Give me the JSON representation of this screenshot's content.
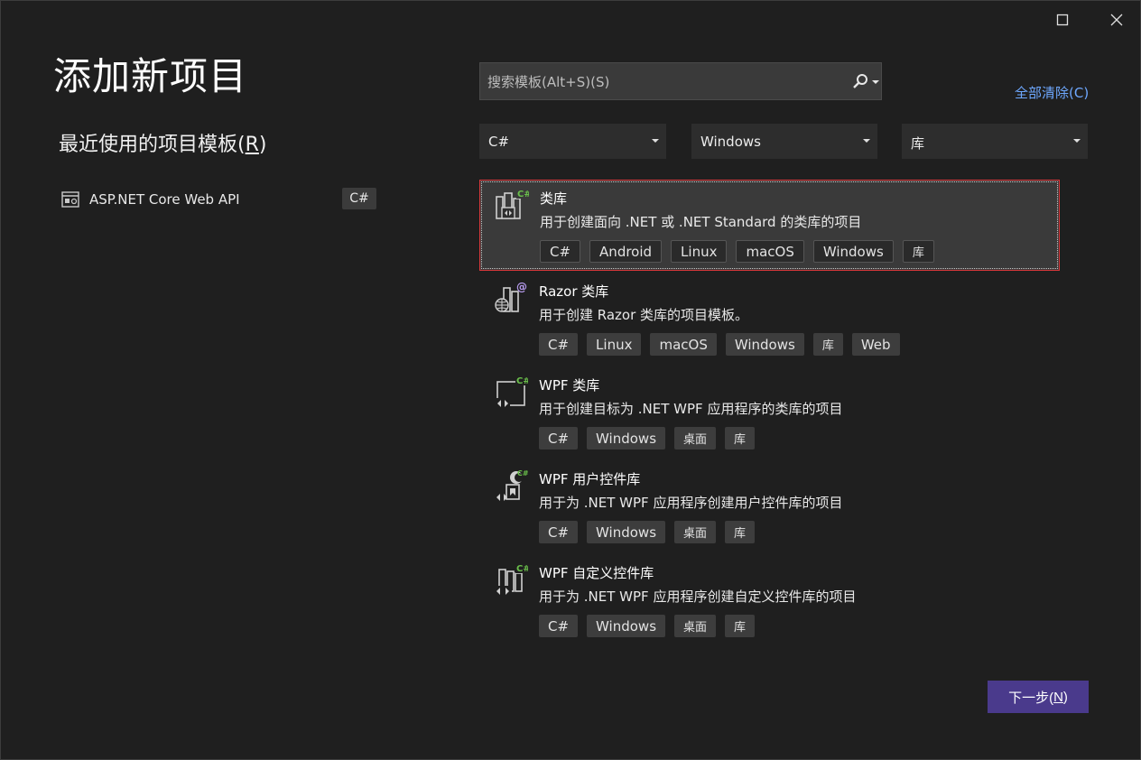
{
  "window": {
    "title": "添加新项目",
    "controls": [
      "maximize-icon",
      "close-icon"
    ]
  },
  "recent": {
    "heading": "最近使用的项目模板(R)",
    "heading_plain": "最近使用的项目模板(",
    "heading_key": "R",
    "heading_end": ")",
    "items": [
      {
        "label": "ASP.NET Core Web API",
        "lang": "C#",
        "icon": "web-api-icon"
      }
    ]
  },
  "search": {
    "placeholder": "搜索模板(Alt+S)(S)",
    "value": "",
    "icon": "search-icon"
  },
  "clear_all": "全部清除(C)",
  "filters": {
    "language": "C#",
    "platform": "Windows",
    "project_type": "库"
  },
  "templates": [
    {
      "name": "类库",
      "desc": "用于创建面向 .NET 或 .NET Standard 的类库的项目",
      "tags": [
        "C#",
        "Android",
        "Linux",
        "macOS",
        "Windows",
        "库"
      ],
      "icon": "class-library-icon",
      "selected": true
    },
    {
      "name": "Razor 类库",
      "desc": "用于创建 Razor 类库的项目模板。",
      "tags": [
        "C#",
        "Linux",
        "macOS",
        "Windows",
        "库",
        "Web"
      ],
      "icon": "razor-library-icon"
    },
    {
      "name": "WPF 类库",
      "desc": "用于创建目标为 .NET WPF 应用程序的类库的项目",
      "tags": [
        "C#",
        "Windows",
        "桌面",
        "库"
      ],
      "icon": "wpf-library-icon"
    },
    {
      "name": "WPF 用户控件库",
      "desc": "用于为 .NET WPF 应用程序创建用户控件库的项目",
      "tags": [
        "C#",
        "Windows",
        "桌面",
        "库"
      ],
      "icon": "wpf-user-control-icon"
    },
    {
      "name": "WPF 自定义控件库",
      "desc": "用于为 .NET WPF 应用程序创建自定义控件库的项目",
      "tags": [
        "C#",
        "Windows",
        "桌面",
        "库"
      ],
      "icon": "wpf-custom-control-icon"
    }
  ],
  "next_button": "下一步(N)",
  "next_plain": "下一步(",
  "next_key": "N",
  "next_end": ")",
  "colors": {
    "background": "#1f1f1f",
    "accent": "#4a3a8c",
    "link": "#6ea8ff",
    "selection_border": "#d9373a",
    "csharp_badge": "#6abf4b"
  }
}
